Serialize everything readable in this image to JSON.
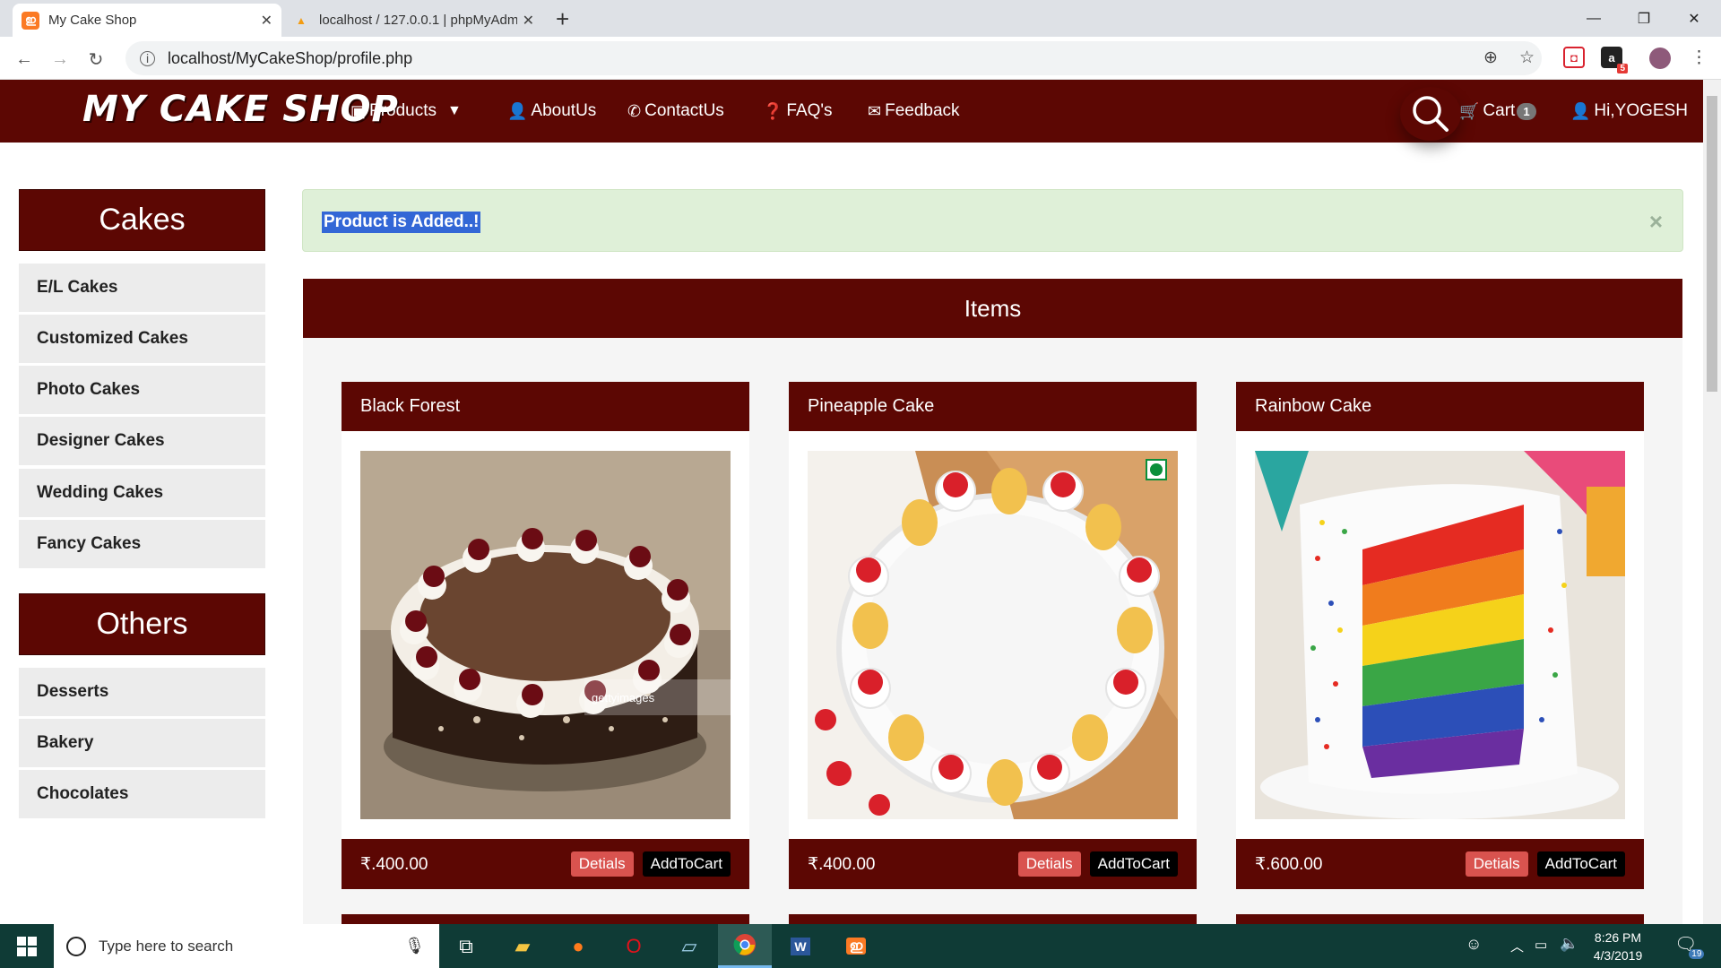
{
  "browser": {
    "tabs": [
      {
        "title": "My Cake Shop",
        "favicon": "xampp-icon",
        "active": true
      },
      {
        "title": "localhost / 127.0.0.1 | phpMyAdm",
        "favicon": "phpmyadmin-icon",
        "active": false
      }
    ],
    "new_tab": "+",
    "url": "localhost/MyCakeShop/profile.php",
    "ext_badge": "5"
  },
  "site": {
    "logo": "MY CAKE SHOP",
    "nav": {
      "products": "Products",
      "about": "AboutUs",
      "contact": "ContactUs",
      "faq": "FAQ's",
      "feedback": "Feedback",
      "cart": "Cart",
      "cart_count": "1",
      "user": "Hi,YOGESH"
    }
  },
  "sidebar": {
    "cakes_heading": "Cakes",
    "cakes": [
      "E/L Cakes",
      "Customized Cakes",
      "Photo Cakes",
      "Designer Cakes",
      "Wedding Cakes",
      "Fancy Cakes"
    ],
    "others_heading": "Others",
    "others": [
      "Desserts",
      "Bakery",
      "Chocolates"
    ]
  },
  "alert": {
    "message": "Product is Added..!",
    "close": "×"
  },
  "items": {
    "heading": "Items",
    "products": [
      {
        "name": "Black Forest",
        "price": "₹.400.00",
        "details": "Detials",
        "add": "AddToCart"
      },
      {
        "name": "Pineapple Cake",
        "price": "₹.400.00",
        "details": "Detials",
        "add": "AddToCart"
      },
      {
        "name": "Rainbow Cake",
        "price": "₹.600.00",
        "details": "Detials",
        "add": "AddToCart"
      }
    ]
  },
  "taskbar": {
    "search_placeholder": "Type here to search",
    "time": "8:26 PM",
    "date": "4/3/2019",
    "notif_count": "19"
  }
}
